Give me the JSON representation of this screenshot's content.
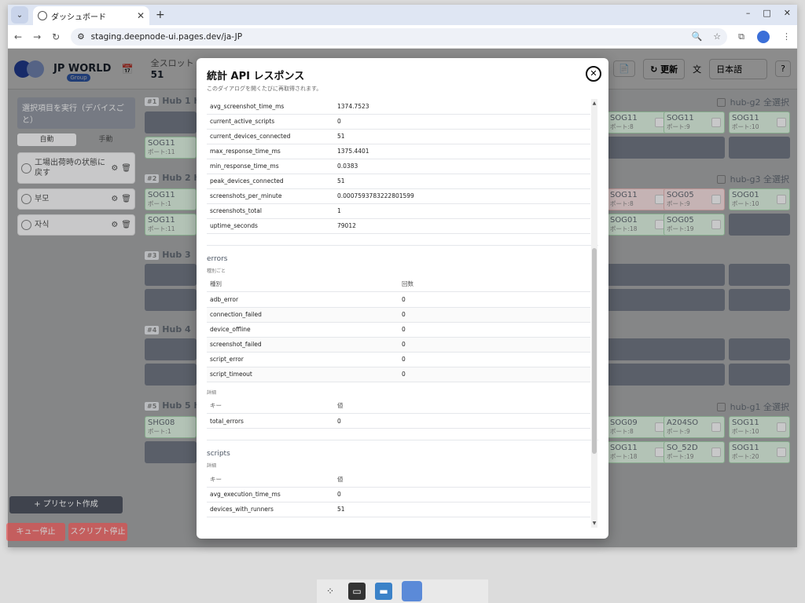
{
  "browser": {
    "tab_title": "ダッシュボード",
    "url": "staging.deepnode-ui.pages.dev/ja-JP"
  },
  "app": {
    "brand": "JP WORLD",
    "brand_badge": "Group",
    "slots_label": "全スロット",
    "slots_value": "51",
    "update_label": "更新",
    "language": "日本語"
  },
  "sidebar": {
    "run_label": "選択項目を実行（デバイスごと）",
    "mode_auto": "自動",
    "mode_manual": "手動",
    "presets": [
      {
        "name": "工場出荷時の状態に戻す"
      },
      {
        "name": "부모"
      },
      {
        "name": "자식"
      }
    ],
    "create_label": "+ プリセット作成",
    "stop_queue": "キュー停止",
    "stop_script": "スクリプト停止"
  },
  "hubs": [
    {
      "num": "#1",
      "name": "Hub 1 h",
      "select": "hub-g2 全選択"
    },
    {
      "num": "#2",
      "name": "Hub 2 h",
      "select": "hub-g3 全選択"
    },
    {
      "num": "#3",
      "name": "Hub 3",
      "select": ""
    },
    {
      "num": "#4",
      "name": "Hub 4",
      "select": ""
    },
    {
      "num": "#5",
      "name": "Hub 5 h",
      "select": "hub-g1 全選択"
    }
  ],
  "cells": {
    "h1_left": {
      "name": "SOG11",
      "port": "ポート:11"
    },
    "h1_r1": {
      "name": "SOG11",
      "port": "ポート:8"
    },
    "h1_r2": {
      "name": "SOG11",
      "port": "ポート:9"
    },
    "h1_r3": {
      "name": "SOG11",
      "port": "ポート:10"
    },
    "h2_left1": {
      "name": "SOG11",
      "port": "ポート:1"
    },
    "h2_left2": {
      "name": "SOG11",
      "port": "ポート:11"
    },
    "h2_r1": {
      "name": "SOG11",
      "port": "ポート:8"
    },
    "h2_r2": {
      "name": "SOG05",
      "port": "ポート:9"
    },
    "h2_r3": {
      "name": "SOG01",
      "port": "ポート:10"
    },
    "h2_r4": {
      "name": "SOG01",
      "port": "ポート:18"
    },
    "h2_r5": {
      "name": "SOG05",
      "port": "ポート:19"
    },
    "h5_left": {
      "name": "SHG08",
      "port": "ポート:1"
    },
    "h5_r1": {
      "name": "SOG09",
      "port": "ポート:8"
    },
    "h5_r2": {
      "name": "A204SO",
      "port": "ポート:9"
    },
    "h5_r3": {
      "name": "SOG11",
      "port": "ポート:10"
    },
    "h5_r4": {
      "name": "SOG11",
      "port": "ポート:18"
    },
    "h5_r5": {
      "name": "SO_52D",
      "port": "ポート:19"
    },
    "h5_r6": {
      "name": "SOG11",
      "port": "ポート:20"
    }
  },
  "modal": {
    "title": "統計 API レスポンス",
    "subtitle": "このダイアログを開くたびに再取得されます。",
    "stats_rows": [
      {
        "key": "avg_screenshot_time_ms",
        "value": "1374.7523"
      },
      {
        "key": "current_active_scripts",
        "value": "0"
      },
      {
        "key": "current_devices_connected",
        "value": "51"
      },
      {
        "key": "max_response_time_ms",
        "value": "1375.4401"
      },
      {
        "key": "min_response_time_ms",
        "value": "0.0383"
      },
      {
        "key": "peak_devices_connected",
        "value": "51"
      },
      {
        "key": "screenshots_per_minute",
        "value": "0.0007593783222801599"
      },
      {
        "key": "screenshots_total",
        "value": "1"
      },
      {
        "key": "uptime_seconds",
        "value": "79012"
      }
    ],
    "errors": {
      "title": "errors",
      "by_type_label": "種別ごと",
      "col_type": "種別",
      "col_count": "回数",
      "rows": [
        {
          "key": "adb_error",
          "value": "0"
        },
        {
          "key": "connection_failed",
          "value": "0"
        },
        {
          "key": "device_offline",
          "value": "0"
        },
        {
          "key": "screenshot_failed",
          "value": "0"
        },
        {
          "key": "script_error",
          "value": "0"
        },
        {
          "key": "script_timeout",
          "value": "0"
        }
      ],
      "detail_label": "詳細",
      "col_key": "キー",
      "col_value": "値",
      "detail_rows": [
        {
          "key": "total_errors",
          "value": "0"
        }
      ]
    },
    "scripts": {
      "title": "scripts",
      "detail_label": "詳細",
      "col_key": "キー",
      "col_value": "値",
      "rows": [
        {
          "key": "avg_execution_time_ms",
          "value": "0"
        },
        {
          "key": "devices_with_runners",
          "value": "51"
        }
      ]
    }
  }
}
